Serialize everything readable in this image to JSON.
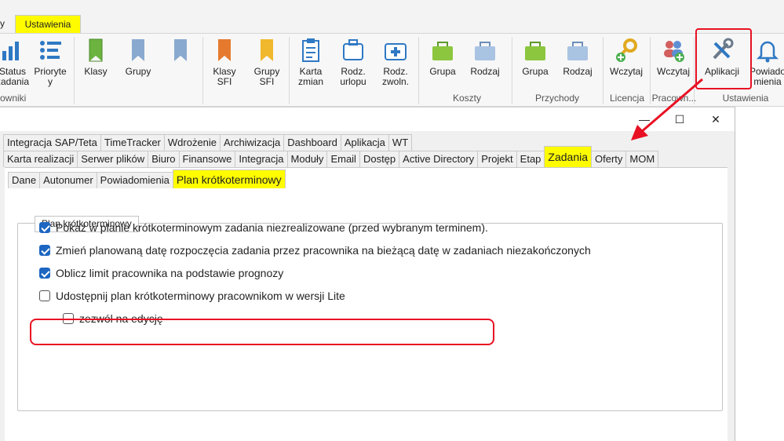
{
  "ribbon_tabs": {
    "partial_left": "y",
    "active": "Ustawienia"
  },
  "ribbon": {
    "buttons": [
      {
        "label": "Status\nzadania",
        "icon": "status-chart-icon"
      },
      {
        "label": "Prioryte\ny",
        "icon": "priority-list-icon"
      },
      {
        "label": "Klasy",
        "icon": "bookmark-green-icon"
      },
      {
        "label": "Grupy",
        "icon": "bookmark-blue-icon"
      },
      {
        "label": "",
        "icon": "bookmark-blue-icon"
      },
      {
        "label": "Klasy\nSFI",
        "icon": "bookmark-orange-icon"
      },
      {
        "label": "Grupy\nSFI",
        "icon": "bookmark-yellow-icon"
      },
      {
        "label": "Karta\nzmian",
        "icon": "clipboard-icon"
      },
      {
        "label": "Rodz.\nurlopu",
        "icon": "suitcase-icon"
      },
      {
        "label": "Rodz.\nzwoln.",
        "icon": "medical-kit-icon"
      },
      {
        "label": "Grupa",
        "icon": "bag-green-icon"
      },
      {
        "label": "Rodzaj",
        "icon": "bag-blue-icon"
      },
      {
        "label": "Grupa",
        "icon": "bag-green-icon"
      },
      {
        "label": "Rodzaj",
        "icon": "bag-blue-icon"
      },
      {
        "label": "Wczytaj",
        "icon": "key-plus-icon"
      },
      {
        "label": "Wczytaj",
        "icon": "users-plus-icon"
      },
      {
        "label": "Aplikacji",
        "icon": "tools-icon"
      },
      {
        "label": "Powiado\nmienia",
        "icon": "bell-icon"
      }
    ],
    "groups": [
      "owniki",
      "Koszty",
      "Przychody",
      "Licencja",
      "Pracown...",
      "Ustawienia"
    ]
  },
  "window_controls": {
    "minimize": "—",
    "maximize": "☐",
    "close": "✕"
  },
  "tabs_row1": [
    "Integracja SAP/Teta",
    "TimeTracker",
    "Wdrożenie",
    "Archiwizacja",
    "Dashboard",
    "Aplikacja",
    "WT"
  ],
  "tabs_row2": [
    "Karta realizacji",
    "Serwer plików",
    "Biuro",
    "Finansowe",
    "Integracja",
    "Moduły",
    "Email",
    "Dostęp",
    "Active Directory",
    "Projekt",
    "Etap",
    "Zadania",
    "Oferty",
    "MOM"
  ],
  "tabs_row2_active": "Zadania",
  "subtabs": [
    "Dane",
    "Autonumer",
    "Powiadomienia",
    "Plan krótkoterminowy"
  ],
  "subtabs_active": "Plan krótkoterminowy",
  "group_title": "Plan krótkoterminowy",
  "options": [
    {
      "label": "Pokaż w planie krótkoterminowym zadania niezrealizowane (przed wybranym terminem).",
      "checked": true
    },
    {
      "label": "Zmień planowaną datę rozpoczęcia zadania przez pracownika na bieżącą datę w zadaniach niezakończonych",
      "checked": true
    },
    {
      "label": "Oblicz limit pracownika na podstawie prognozy",
      "checked": true
    },
    {
      "label": "Udostępnij plan krótkoterminowy pracownikom w wersji Lite",
      "checked": false
    },
    {
      "label": "zezwól na edycję",
      "checked": false
    }
  ],
  "colors": {
    "highlight": "#fffc00",
    "annotation_red": "#e81123",
    "checkbox_blue": "#1d66c2"
  }
}
